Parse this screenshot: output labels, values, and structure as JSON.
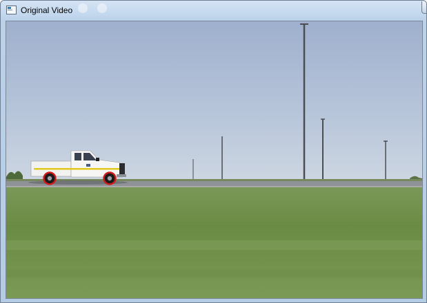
{
  "window": {
    "title": "Original Video",
    "icon": "app-window-icon",
    "buttons": {
      "minimize_icon": "minimize-icon",
      "maximize_icon": "restore-icon",
      "close_icon": "close-icon",
      "close_glyph": "✕"
    },
    "accent_close": "#c8442a",
    "frame_color": "#b9cfe8"
  },
  "video": {
    "scene": "pickup truck driving on road with light poles and grass field",
    "colors": {
      "sky_top": "#9fb2d0",
      "sky_bottom": "#c8d3e0",
      "grass": "#6f8f45",
      "road": "#8d8f92",
      "wheel_marker": "#d11a1a"
    }
  }
}
